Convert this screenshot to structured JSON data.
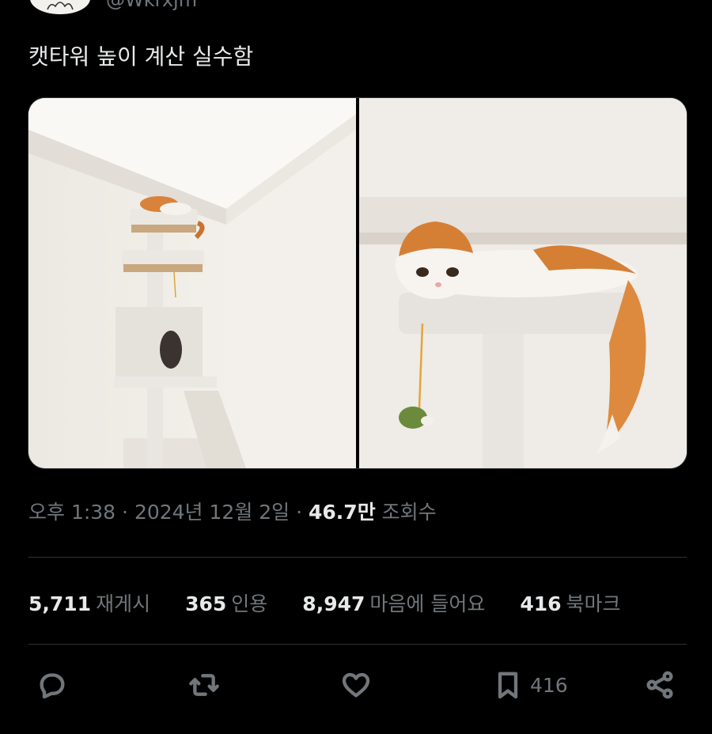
{
  "header": {
    "handle": "@Wkrxjm"
  },
  "tweet": {
    "text": "캣타워 높이 계산 실수함"
  },
  "media": {
    "left_alt": "cat-tower-photo",
    "right_alt": "cat-on-tower-closeup"
  },
  "meta": {
    "time": "오후 1:38",
    "sep1": " · ",
    "date": "2024년 12월 2일",
    "sep2": " · ",
    "views_count": "46.7만",
    "views_label": "조회수"
  },
  "stats": {
    "reposts": {
      "num": "5,711",
      "label": "재게시"
    },
    "quotes": {
      "num": "365",
      "label": "인용"
    },
    "likes": {
      "num": "8,947",
      "label": "마음에 들어요"
    },
    "bookmarks": {
      "num": "416",
      "label": "북마크"
    }
  },
  "actions": {
    "reply_icon": "reply-icon",
    "repost_icon": "repost-icon",
    "like_icon": "heart-icon",
    "bookmark_icon": "bookmark-icon",
    "bookmark_count": "416",
    "share_icon": "share-icon"
  },
  "colors": {
    "background": "#000000",
    "text_primary": "#e7e9ea",
    "text_secondary": "#71767b",
    "divider": "#2f3336"
  }
}
